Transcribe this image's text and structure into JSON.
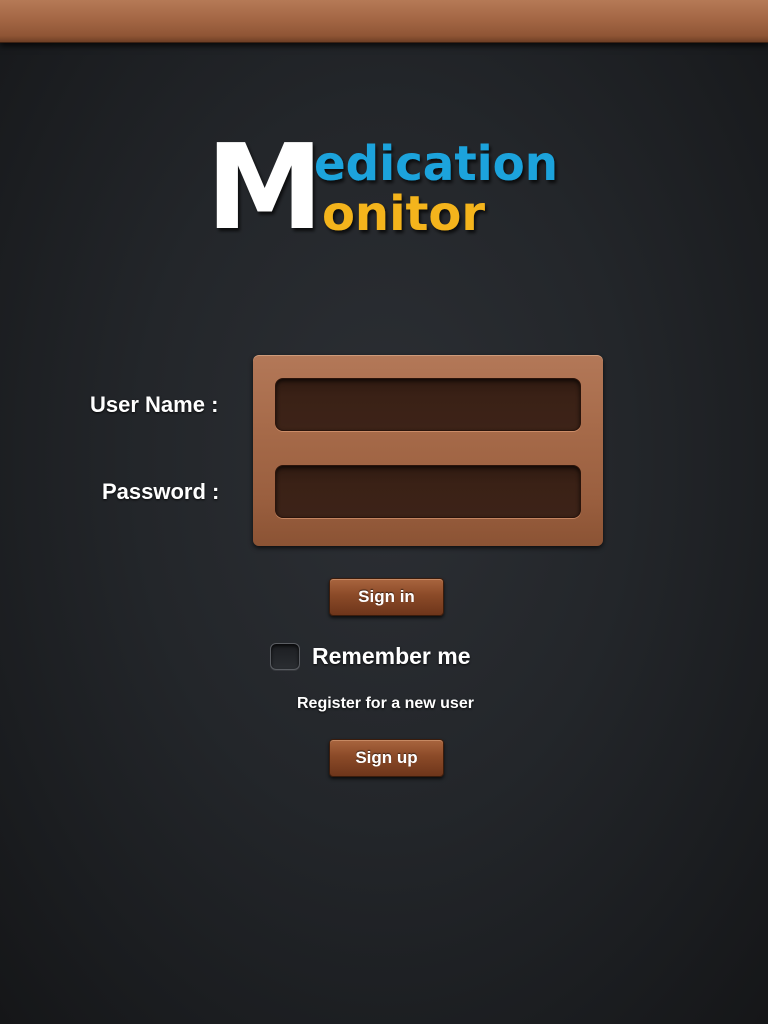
{
  "app": {
    "logo_alt": "Medication Monitor",
    "logo_first_initial": "M",
    "logo_line1": "edication",
    "logo_line2": "onitor",
    "logo_colors": {
      "initial": "#ffffff",
      "line1": "#1aa3dc",
      "line2": "#f4b41a"
    }
  },
  "login": {
    "username_label": "User Name :",
    "username_value": "",
    "password_label": "Password :",
    "password_value": "",
    "signin_label": "Sign in",
    "remember_label": "Remember me",
    "remember_checked": false,
    "register_text": "Register for a new user",
    "signup_label": "Sign up"
  },
  "theme": {
    "background": "#23262a",
    "leather": "#a66a49",
    "field_fill": "#3a2116",
    "button_fill": "#8b4a28",
    "text": "#ffffff"
  }
}
